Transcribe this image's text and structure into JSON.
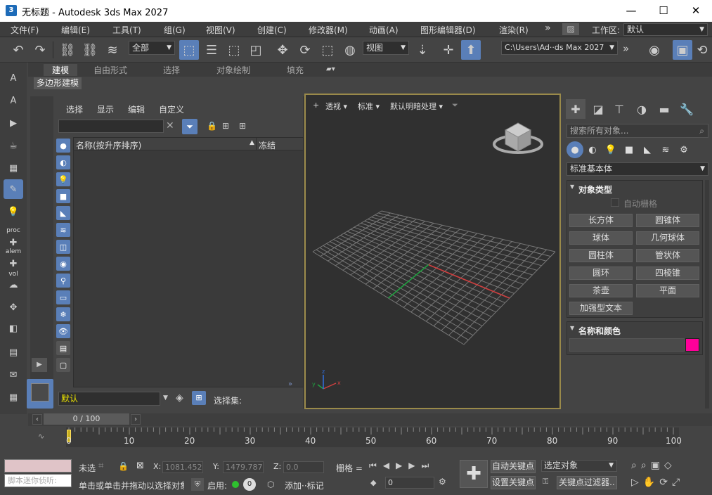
{
  "window": {
    "app_icon": "3",
    "title": "无标题 - Autodesk 3ds Max 2027",
    "minimize": "—",
    "maximize": "☐",
    "close": "✕"
  },
  "menu": {
    "items": [
      "文件(F)",
      "编辑(E)",
      "工具(T)",
      "组(G)",
      "视图(V)",
      "创建(C)",
      "修改器(M)",
      "动画(A)",
      "图形编辑器(D)",
      "渲染(R)"
    ],
    "more": "»",
    "workspace_label": "工作区:",
    "workspace_value": "默认"
  },
  "toolbar": {
    "selection_filter": "全部",
    "ref_coord": "视图",
    "project_path": "C:\\Users\\Ad··ds Max 2027",
    "more": "»"
  },
  "ribbon": {
    "tabs": [
      "建模",
      "自由形式",
      "选择",
      "对象绘制",
      "填充"
    ],
    "active_tab": "建模",
    "sub_label": "多边形建模"
  },
  "left_toolbar": {
    "proc": "proc",
    "alem": "alem",
    "vol": "vol"
  },
  "scene_explorer": {
    "menus": [
      "选择",
      "显示",
      "编辑",
      "自定义"
    ],
    "col_name": "名称(按升序排序)",
    "col_frozen": "冻结",
    "layer": "默认",
    "selection_set_label": "选择集:"
  },
  "viewport": {
    "labels": [
      "+",
      "透视",
      "标准",
      "默认明暗处理"
    ],
    "gizmo_labels": {
      "x": "x",
      "y": "y",
      "z": "z"
    }
  },
  "command_panel": {
    "search_placeholder": "搜索所有对象...",
    "category": "标准基本体",
    "rollout_object_type": "对象类型",
    "auto_grid": "自动栅格",
    "objects": [
      "长方体",
      "圆锥体",
      "球体",
      "几何球体",
      "圆柱体",
      "管状体",
      "圆环",
      "四棱锥",
      "茶壶",
      "平面",
      "加强型文本"
    ],
    "rollout_name_color": "名称和颜色",
    "object_color": "#ff0099"
  },
  "timeline": {
    "slider": "0 / 100",
    "ticks": [
      "0",
      "10",
      "20",
      "30",
      "40",
      "50",
      "60",
      "70",
      "80",
      "90",
      "100"
    ]
  },
  "status": {
    "script_placeholder": "脚本迷你侦听:",
    "not_selected": "未选",
    "prompt": "单击或单击并拖动以选择对象",
    "x_label": "X:",
    "x_value": "1081.452",
    "y_label": "Y:",
    "y_value": "1479.787",
    "z_label": "Z:",
    "z_value": "0.0",
    "grid": "栅格 =",
    "enable_label": "启用:",
    "enable_value": "0",
    "add_tag": "添加··标记",
    "auto_key": "自动关键点",
    "set_key": "设置关键点",
    "selected_object": "选定对象",
    "key_filters": "关键点过滤器..",
    "frame": "0"
  }
}
